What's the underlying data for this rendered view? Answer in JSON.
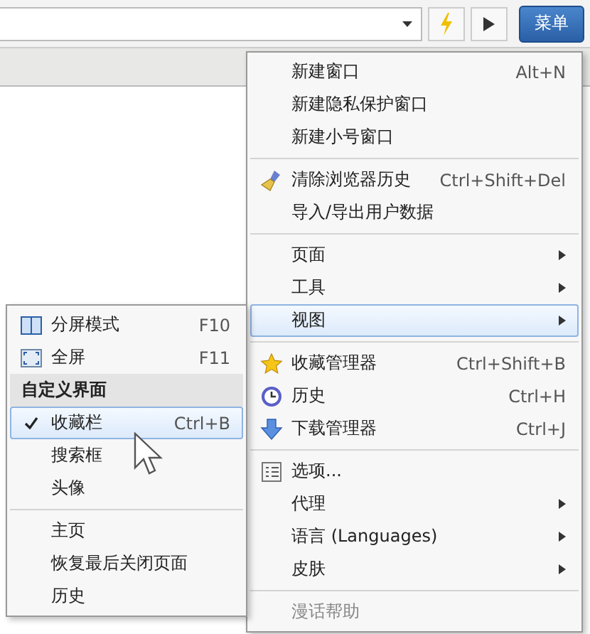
{
  "toolbar": {
    "menu_button": "菜单"
  },
  "main_menu": {
    "groups": [
      [
        {
          "label": "新建窗口",
          "shortcut": "Alt+N",
          "has_submenu": false,
          "selected": false,
          "disabled": false
        },
        {
          "label": "新建隐私保护窗口",
          "has_submenu": false,
          "selected": false,
          "disabled": false
        },
        {
          "label": "新建小号窗口",
          "has_submenu": false,
          "selected": false,
          "disabled": false
        }
      ],
      [
        {
          "label": "清除浏览器历史",
          "shortcut": "Ctrl+Shift+Del",
          "has_submenu": false,
          "selected": false,
          "disabled": false
        },
        {
          "label": "导入/导出用户数据",
          "has_submenu": false,
          "selected": false,
          "disabled": false
        }
      ],
      [
        {
          "label": "页面",
          "has_submenu": true,
          "selected": false,
          "disabled": false
        },
        {
          "label": "工具",
          "has_submenu": true,
          "selected": false,
          "disabled": false
        },
        {
          "label": "视图",
          "has_submenu": true,
          "selected": true,
          "disabled": false
        }
      ],
      [
        {
          "label": "收藏管理器",
          "shortcut": "Ctrl+Shift+B",
          "has_submenu": false,
          "selected": false,
          "disabled": false
        },
        {
          "label": "历史",
          "shortcut": "Ctrl+H",
          "has_submenu": false,
          "selected": false,
          "disabled": false
        },
        {
          "label": "下载管理器",
          "shortcut": "Ctrl+J",
          "has_submenu": false,
          "selected": false,
          "disabled": false
        }
      ],
      [
        {
          "label": "选项...",
          "has_submenu": false,
          "selected": false,
          "disabled": false
        },
        {
          "label": "代理",
          "has_submenu": true,
          "selected": false,
          "disabled": false
        },
        {
          "label": "语言 (Languages)",
          "has_submenu": true,
          "selected": false,
          "disabled": false
        },
        {
          "label": "皮肤",
          "has_submenu": true,
          "selected": false,
          "disabled": false
        }
      ],
      [
        {
          "label": "漫话帮助",
          "has_submenu": false,
          "selected": false,
          "disabled": true
        }
      ]
    ]
  },
  "view_submenu": {
    "groups": [
      {
        "items": [
          {
            "label": "分屏模式",
            "shortcut": "F10",
            "checked": false,
            "selected": false
          },
          {
            "label": "全屏",
            "shortcut": "F11",
            "checked": false,
            "selected": false
          }
        ]
      },
      {
        "header": "自定义界面",
        "items": [
          {
            "label": "收藏栏",
            "shortcut": "Ctrl+B",
            "checked": true,
            "selected": true
          },
          {
            "label": "搜索框",
            "checked": false,
            "selected": false
          },
          {
            "label": "头像",
            "checked": false,
            "selected": false
          }
        ]
      },
      {
        "items": [
          {
            "label": "主页",
            "checked": false,
            "selected": false
          },
          {
            "label": "恢复最后关闭页面",
            "checked": false,
            "selected": false
          },
          {
            "label": "历史",
            "checked": false,
            "selected": false
          }
        ]
      }
    ]
  }
}
